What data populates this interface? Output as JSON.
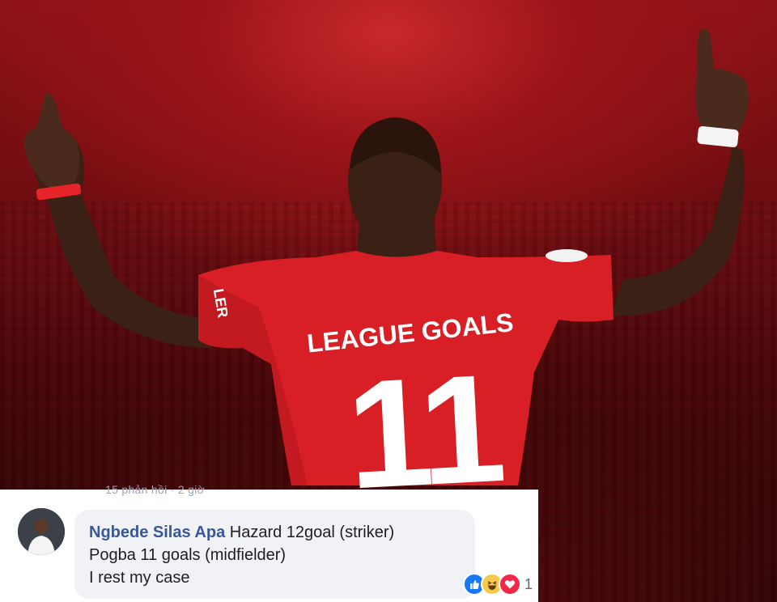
{
  "photo": {
    "shirt_text": "LEAGUE GOALS",
    "shirt_number": "11",
    "sleeve_text": "LER"
  },
  "comment": {
    "previous_meta": "15 phản hồi · 2 giờ",
    "author": "Ngbede Silas Apa",
    "line1": "Hazard 12goal (striker)",
    "line2": "Pogba 11 goals (midfielder)",
    "line3": "I rest my case",
    "reaction_count": "1",
    "reactions": [
      "like-icon",
      "haha-icon",
      "love-icon"
    ]
  },
  "colors": {
    "author": "#385898",
    "bubble": "#f0f2f5",
    "like": "#1877f2",
    "haha": "#f7c94b",
    "love": "#f0284a",
    "shirt": "#d81f26"
  }
}
